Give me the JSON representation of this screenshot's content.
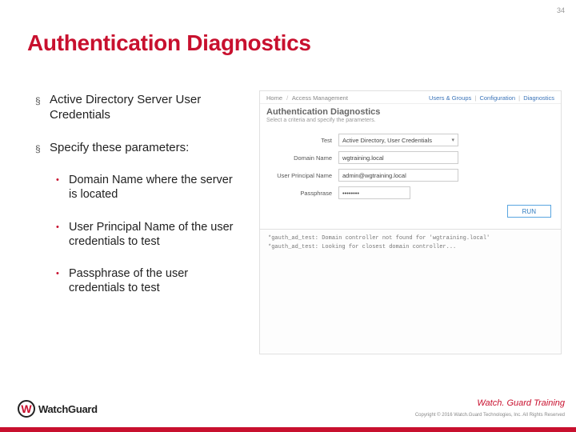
{
  "slide_number": "34",
  "title": "Authentication Diagnostics",
  "bullets": {
    "l1": [
      "Active Directory Server User Credentials",
      "Specify these parameters:"
    ],
    "l2": [
      "Domain Name where the server is located",
      "User Principal Name of the user credentials to test",
      "Passphrase of the user credentials to test"
    ]
  },
  "panel": {
    "breadcrumb": {
      "a": "Home",
      "b": "Access Management"
    },
    "nav": {
      "a": "Users & Groups",
      "b": "Configuration",
      "c": "Diagnostics"
    },
    "title": "Authentication Diagnostics",
    "subtitle": "Select a criteria and specify the parameters.",
    "form": {
      "test_label": "Test",
      "test_value": "Active Directory, User Credentials",
      "domain_label": "Domain Name",
      "domain_value": "wgtraining.local",
      "upn_label": "User Principal Name",
      "upn_value": "admin@wgtraining.local",
      "pass_label": "Passphrase",
      "pass_value": "••••••••",
      "run": "RUN"
    },
    "output_line1": "*gauth_ad_test: Domain controller not found for 'wgtraining.local'",
    "output_line2": "*gauth_ad_test: Looking for closest domain controller..."
  },
  "footer": {
    "training": "Watch. Guard Training",
    "copyright": "Copyright © 2016 Watch.Guard Technologies, Inc. All Rights Reserved",
    "logo_text": "WatchGuard"
  }
}
